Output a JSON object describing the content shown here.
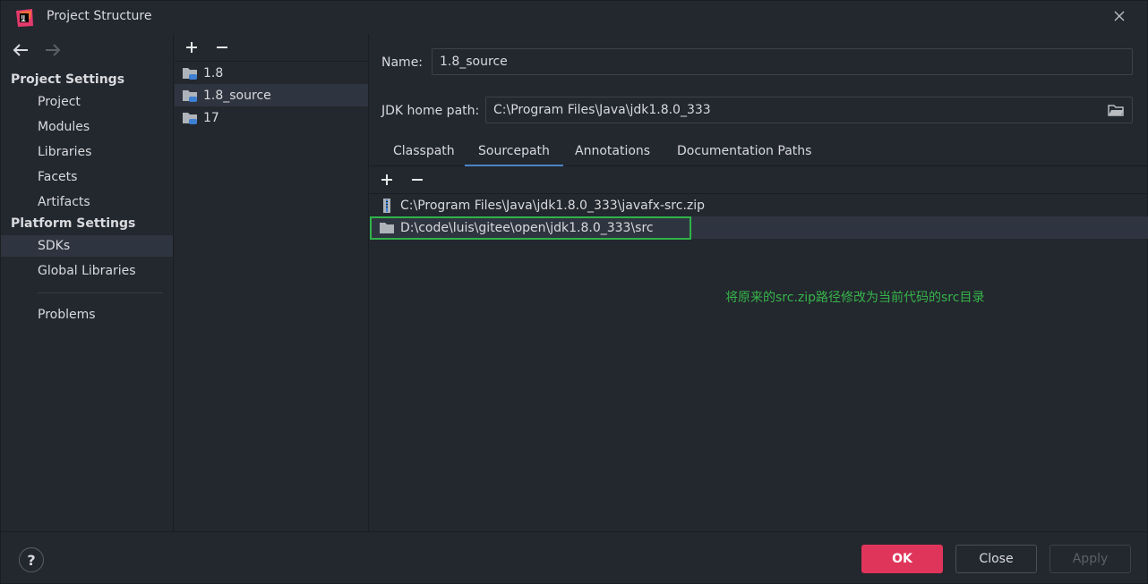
{
  "window": {
    "title": "Project Structure"
  },
  "nav": {
    "groups": {
      "project_settings": "Project Settings",
      "platform_settings": "Platform Settings"
    },
    "items": {
      "project": "Project",
      "modules": "Modules",
      "libraries": "Libraries",
      "facets": "Facets",
      "artifacts": "Artifacts",
      "sdks": "SDKs",
      "global_libraries": "Global Libraries",
      "problems": "Problems"
    },
    "selected": "SDKs"
  },
  "sdk_list": {
    "items": [
      "1.8",
      "1.8_source",
      "17"
    ],
    "selected": "1.8_source"
  },
  "detail": {
    "name_label": "Name:",
    "name_value": "1.8_source",
    "jdk_label": "JDK home path:",
    "jdk_value": "C:\\Program Files\\Java\\jdk1.8.0_333",
    "tabs": [
      "Classpath",
      "Sourcepath",
      "Annotations",
      "Documentation Paths"
    ],
    "active_tab": "Sourcepath",
    "paths": [
      "C:\\Program Files\\Java\\jdk1.8.0_333\\javafx-src.zip",
      "D:\\code\\luis\\gitee\\open\\jdk1.8.0_333\\src"
    ],
    "annotation": "将原来的src.zip路径修改为当前代码的src目录"
  },
  "footer": {
    "help": "?",
    "ok": "OK",
    "close": "Close",
    "apply": "Apply"
  },
  "colors": {
    "background": "#23272e",
    "selection": "#2f3540",
    "accent_ok": "#e0355a",
    "annotation_green": "#36b54a",
    "tab_underline": "#4a86c7"
  }
}
